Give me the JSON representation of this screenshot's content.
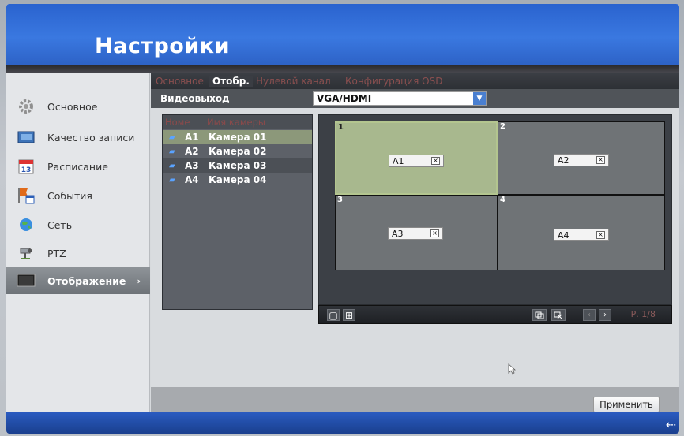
{
  "header": {
    "title": "Настройки"
  },
  "sidebar": {
    "items": [
      {
        "label": "Основное",
        "icon": "gear-icon"
      },
      {
        "label": "Качество записи",
        "icon": "film-icon"
      },
      {
        "label": "Расписание",
        "icon": "calendar-icon"
      },
      {
        "label": "События",
        "icon": "flag-calendar-icon"
      },
      {
        "label": "Сеть",
        "icon": "globe-icon"
      },
      {
        "label": "PTZ",
        "icon": "ptz-camera-icon"
      },
      {
        "label": "Отображение",
        "icon": "monitor-icon"
      }
    ],
    "active_arrow": "›"
  },
  "tabs": [
    "Основное",
    "Отобр.",
    "Нулевой канал",
    "Конфигурация OSD"
  ],
  "video_output": {
    "label": "Видеовыход",
    "value": "VGA/HDMI"
  },
  "camera_list": {
    "headers": [
      "Номе",
      "Имя камеры"
    ],
    "cameras": [
      {
        "id": "A1",
        "name": "Камера 01"
      },
      {
        "id": "A2",
        "name": "Камера 02"
      },
      {
        "id": "A3",
        "name": "Камера 03"
      },
      {
        "id": "A4",
        "name": "Камера 04"
      }
    ]
  },
  "preview": {
    "cells": [
      {
        "num": "1",
        "camera": "A1",
        "close": "×"
      },
      {
        "num": "2",
        "camera": "A2",
        "close": "×"
      },
      {
        "num": "3",
        "camera": "A3",
        "close": "×"
      },
      {
        "num": "4",
        "camera": "A4",
        "close": "×"
      }
    ]
  },
  "controls": {
    "layout1": "▢",
    "layout4": "⊞",
    "prev": "‹",
    "next": "›",
    "page": "Р. 1/8"
  },
  "buttons": {
    "apply": "Применить"
  },
  "footer": {
    "back": "⇠"
  },
  "colors": {
    "header_blue": "#2f6ad6",
    "selected_cell": "#a8b88e",
    "camera_icon": "#5aa3ff"
  }
}
